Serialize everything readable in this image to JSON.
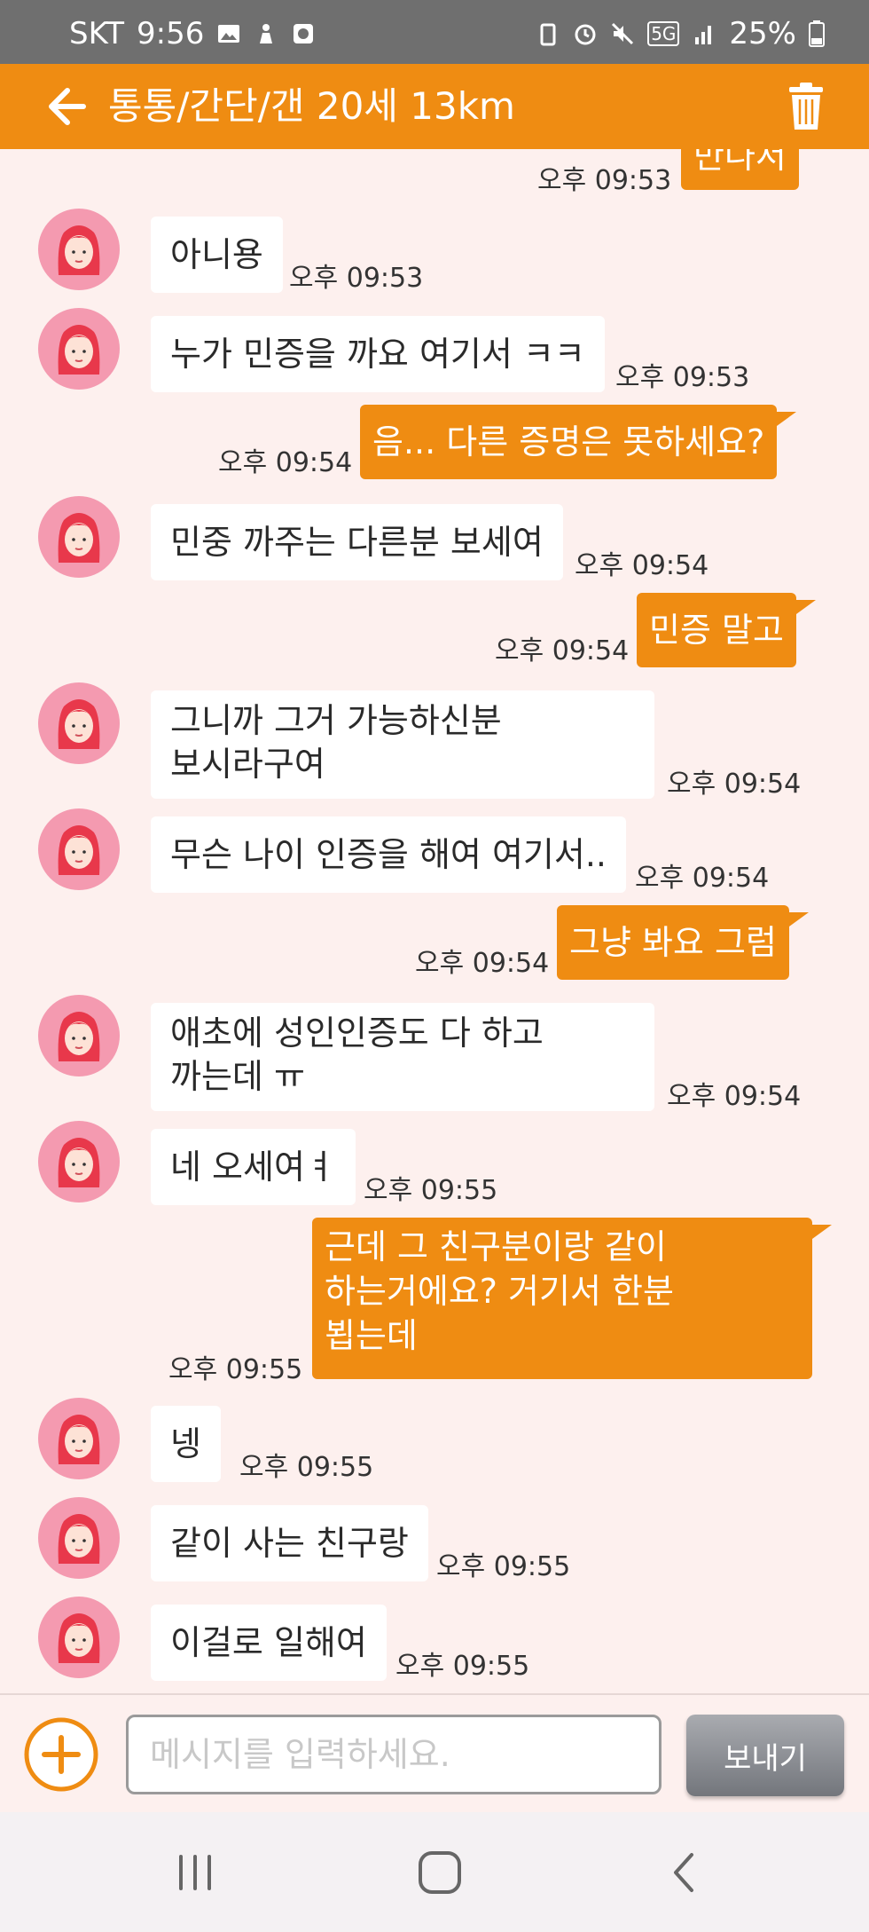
{
  "status_bar": {
    "carrier": "SKT",
    "time": "9:56",
    "network": "5G",
    "battery": "25%"
  },
  "header": {
    "title": "통통/간단/갠 20세 13km",
    "back_icon": "arrow-left-icon",
    "delete_icon": "trash-icon"
  },
  "messages": [
    {
      "side": "out",
      "text": "만나서",
      "time": "오후 09:53"
    },
    {
      "side": "in",
      "text": "아니용",
      "time": "오후 09:53"
    },
    {
      "side": "in",
      "text": "누가 민증을 까요 여기서 ㅋㅋ",
      "time": "오후 09:53"
    },
    {
      "side": "out",
      "text": "음... 다른 증명은 못하세요?",
      "time": "오후 09:54"
    },
    {
      "side": "in",
      "text": "민중 까주는 다른분 보세여",
      "time": "오후 09:54"
    },
    {
      "side": "out",
      "text": "민증 말고",
      "time": "오후 09:54"
    },
    {
      "side": "in",
      "text": "그니까 그거 가능하신분\n보시라구여",
      "time": "오후 09:54"
    },
    {
      "side": "in",
      "text": "무슨 나이 인증을 해여 여기서..",
      "time": "오후 09:54"
    },
    {
      "side": "out",
      "text": "그냥 봐요 그럼",
      "time": "오후 09:54"
    },
    {
      "side": "in",
      "text": "애초에 성인인증도 다 하고\n까는데 ㅠ",
      "time": "오후 09:54"
    },
    {
      "side": "in",
      "text": "네 오세여ㅕ",
      "time": "오후 09:55"
    },
    {
      "side": "out",
      "text": "근데 그 친구분이랑 같이\n하는거에요? 거기서 한분\n뵙는데",
      "time": "오후 09:55"
    },
    {
      "side": "in",
      "text": "넹",
      "time": "오후 09:55"
    },
    {
      "side": "in",
      "text": "같이 사는 친구랑",
      "time": "오후 09:55"
    },
    {
      "side": "in",
      "text": "이걸로 일해여",
      "time": "오후 09:55"
    }
  ],
  "composer": {
    "placeholder": "메시지를 입력하세요.",
    "value": "",
    "send_label": "보내기",
    "add_icon": "plus-circle-icon"
  },
  "nav_bar": {
    "recents_icon": "recents-icon",
    "home_icon": "home-icon",
    "back_icon": "back-chevron-icon"
  },
  "colors": {
    "accent": "#ef8c12",
    "background": "#fdf0ee",
    "status_bar": "#6f6f6f",
    "avatar": "#f49ab0"
  }
}
